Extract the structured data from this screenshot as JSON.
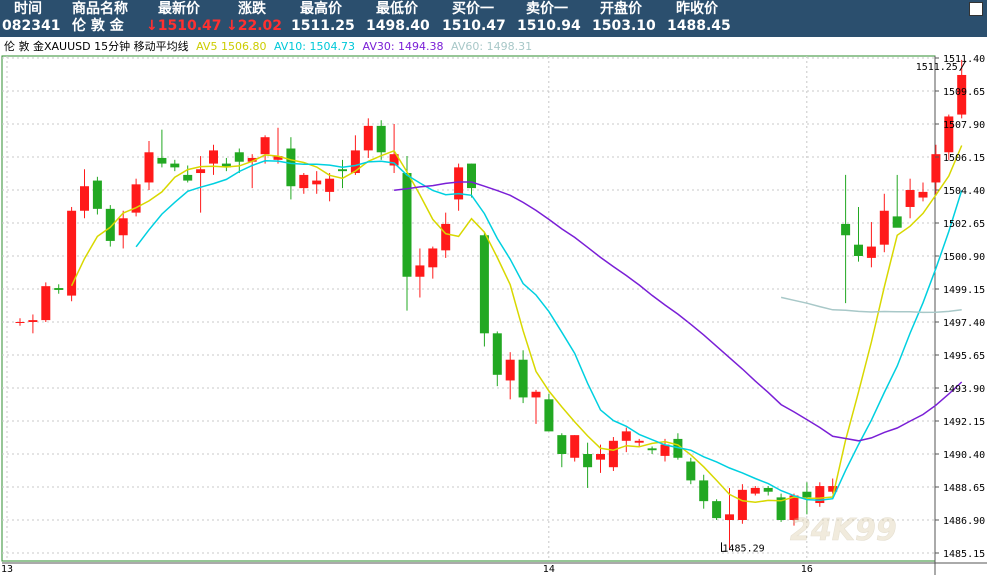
{
  "header": {
    "labels": [
      "时间",
      "商品名称",
      "最新价",
      "涨跌",
      "最高价",
      "最低价",
      "买价一",
      "卖价一",
      "开盘价",
      "昨收价"
    ],
    "values": {
      "time": "082341",
      "name": "伦 敦 金",
      "latest": "↓1510.47",
      "change": "↓22.02",
      "high": "1511.25",
      "low": "1498.40",
      "bid": "1510.47",
      "ask": "1510.94",
      "open": "1503.10",
      "prev_close": "1488.45"
    },
    "colors": {
      "background": "#2b4f6e",
      "down": "#ff3030"
    }
  },
  "legend": {
    "title": "伦 敦 金XAUUSD 15分钟 移动平均线",
    "ma5": "AV5  1506.80",
    "ma10": "AV10: 1504.73",
    "ma30": "AV30: 1494.38",
    "ma60": "AV60: 1498.31"
  },
  "chart_data": {
    "type": "candlestick",
    "y_range": [
      1484.8,
      1512.0
    ],
    "y_ticks": [
      "1511.40",
      "1509.65",
      "1507.90",
      "1506.15",
      "1504.40",
      "1502.65",
      "1500.90",
      "1499.15",
      "1497.40",
      "1495.65",
      "1493.90",
      "1492.15",
      "1490.40",
      "1488.65",
      "1486.90",
      "1485.15"
    ],
    "x_labels": [
      {
        "index": 0,
        "label": "13"
      },
      {
        "index": 42,
        "label": "14"
      },
      {
        "index": 62,
        "label": "16"
      }
    ],
    "candles": [
      [
        1497.4,
        1497.6,
        1497.2,
        1497.4
      ],
      [
        1497.4,
        1497.8,
        1496.8,
        1497.5
      ],
      [
        1497.5,
        1499.5,
        1497.4,
        1499.3
      ],
      [
        1499.2,
        1499.4,
        1498.9,
        1499.1
      ],
      [
        1498.8,
        1503.5,
        1498.5,
        1503.3
      ],
      [
        1503.3,
        1505.5,
        1502.9,
        1504.6
      ],
      [
        1504.9,
        1505.1,
        1503.1,
        1503.4
      ],
      [
        1503.4,
        1503.6,
        1501.4,
        1501.7
      ],
      [
        1502.0,
        1503.3,
        1501.3,
        1502.9
      ],
      [
        1503.2,
        1505.0,
        1503.0,
        1504.7
      ],
      [
        1504.8,
        1507.0,
        1504.4,
        1506.4
      ],
      [
        1506.1,
        1507.6,
        1505.6,
        1505.8
      ],
      [
        1505.8,
        1506.0,
        1505.4,
        1505.6
      ],
      [
        1505.2,
        1505.7,
        1504.8,
        1504.9
      ],
      [
        1505.3,
        1506.2,
        1503.2,
        1505.5
      ],
      [
        1505.8,
        1506.8,
        1505.2,
        1506.5
      ],
      [
        1505.8,
        1506.1,
        1505.4,
        1505.6
      ],
      [
        1506.4,
        1506.6,
        1505.3,
        1505.9
      ],
      [
        1505.9,
        1506.3,
        1504.5,
        1506.1
      ],
      [
        1506.3,
        1507.3,
        1505.8,
        1507.2
      ],
      [
        1506.0,
        1507.7,
        1505.8,
        1506.2
      ],
      [
        1506.6,
        1507.2,
        1503.9,
        1504.6
      ],
      [
        1504.5,
        1505.3,
        1504.2,
        1505.2
      ],
      [
        1504.7,
        1505.4,
        1504.2,
        1504.9
      ],
      [
        1504.3,
        1505.3,
        1503.8,
        1505.0
      ],
      [
        1505.5,
        1506.0,
        1504.5,
        1505.4
      ],
      [
        1505.3,
        1507.3,
        1505.2,
        1506.5
      ],
      [
        1506.5,
        1508.2,
        1506.1,
        1507.8
      ],
      [
        1507.8,
        1508.1,
        1506.0,
        1506.4
      ],
      [
        1505.7,
        1507.9,
        1505.3,
        1506.3
      ],
      [
        1505.3,
        1506.2,
        1498.0,
        1499.8
      ],
      [
        1499.8,
        1501.3,
        1498.7,
        1500.4
      ],
      [
        1500.3,
        1501.4,
        1499.7,
        1501.3
      ],
      [
        1501.2,
        1503.2,
        1500.8,
        1502.6
      ],
      [
        1503.9,
        1505.8,
        1503.3,
        1505.6
      ],
      [
        1505.8,
        1505.8,
        1504.0,
        1504.5
      ],
      [
        1502.0,
        1502.2,
        1496.1,
        1496.8
      ],
      [
        1496.8,
        1496.9,
        1494.0,
        1494.6
      ],
      [
        1494.3,
        1495.8,
        1493.3,
        1495.4
      ],
      [
        1495.4,
        1495.9,
        1493.1,
        1493.4
      ],
      [
        1493.4,
        1493.8,
        1492.0,
        1493.7
      ],
      [
        1493.3,
        1493.6,
        1491.6,
        1491.6
      ],
      [
        1491.4,
        1491.5,
        1489.7,
        1490.4
      ],
      [
        1490.2,
        1491.4,
        1490.0,
        1491.4
      ],
      [
        1490.4,
        1491.0,
        1488.6,
        1489.7
      ],
      [
        1490.1,
        1490.9,
        1489.4,
        1490.4
      ],
      [
        1489.7,
        1491.3,
        1489.5,
        1491.1
      ],
      [
        1491.1,
        1491.8,
        1490.5,
        1491.6
      ],
      [
        1491.0,
        1491.2,
        1490.8,
        1491.1
      ],
      [
        1490.7,
        1490.8,
        1490.4,
        1490.6
      ],
      [
        1490.3,
        1491.2,
        1490.0,
        1490.9
      ],
      [
        1491.2,
        1491.5,
        1490.1,
        1490.2
      ],
      [
        1490.0,
        1490.2,
        1488.8,
        1489.0
      ],
      [
        1489.0,
        1489.3,
        1487.5,
        1487.9
      ],
      [
        1487.9,
        1488.0,
        1486.9,
        1487.0
      ],
      [
        1486.9,
        1488.6,
        1485.3,
        1487.2
      ],
      [
        1486.9,
        1488.8,
        1486.7,
        1488.5
      ],
      [
        1488.3,
        1488.7,
        1488.2,
        1488.6
      ],
      [
        1488.6,
        1488.7,
        1488.2,
        1488.4
      ],
      [
        1488.1,
        1488.3,
        1486.8,
        1486.9
      ],
      [
        1486.9,
        1488.3,
        1486.6,
        1488.2
      ],
      [
        1488.4,
        1488.9,
        1487.2,
        1488.1
      ],
      [
        1487.8,
        1488.9,
        1487.6,
        1488.7
      ],
      [
        1488.4,
        1489.1,
        1488.3,
        1488.7
      ],
      [
        1502.6,
        1505.2,
        1498.4,
        1502.0
      ],
      [
        1501.5,
        1503.5,
        1500.6,
        1500.9
      ],
      [
        1500.8,
        1502.7,
        1500.3,
        1501.4
      ],
      [
        1501.5,
        1504.2,
        1501.1,
        1503.3
      ],
      [
        1503.0,
        1505.2,
        1502.6,
        1502.4
      ],
      [
        1503.5,
        1505.0,
        1502.9,
        1504.4
      ],
      [
        1504.0,
        1504.8,
        1503.8,
        1504.3
      ],
      [
        1504.8,
        1506.8,
        1504.1,
        1506.3
      ],
      [
        1506.4,
        1508.4,
        1506.0,
        1508.3
      ],
      [
        1508.4,
        1511.3,
        1508.2,
        1510.5
      ]
    ],
    "annotations": [
      {
        "text": "1511.25",
        "index": 73,
        "value": 1511.25,
        "marker": "high"
      },
      {
        "text": "1485.29",
        "index": 55,
        "value": 1485.29,
        "marker": "low"
      }
    ]
  }
}
